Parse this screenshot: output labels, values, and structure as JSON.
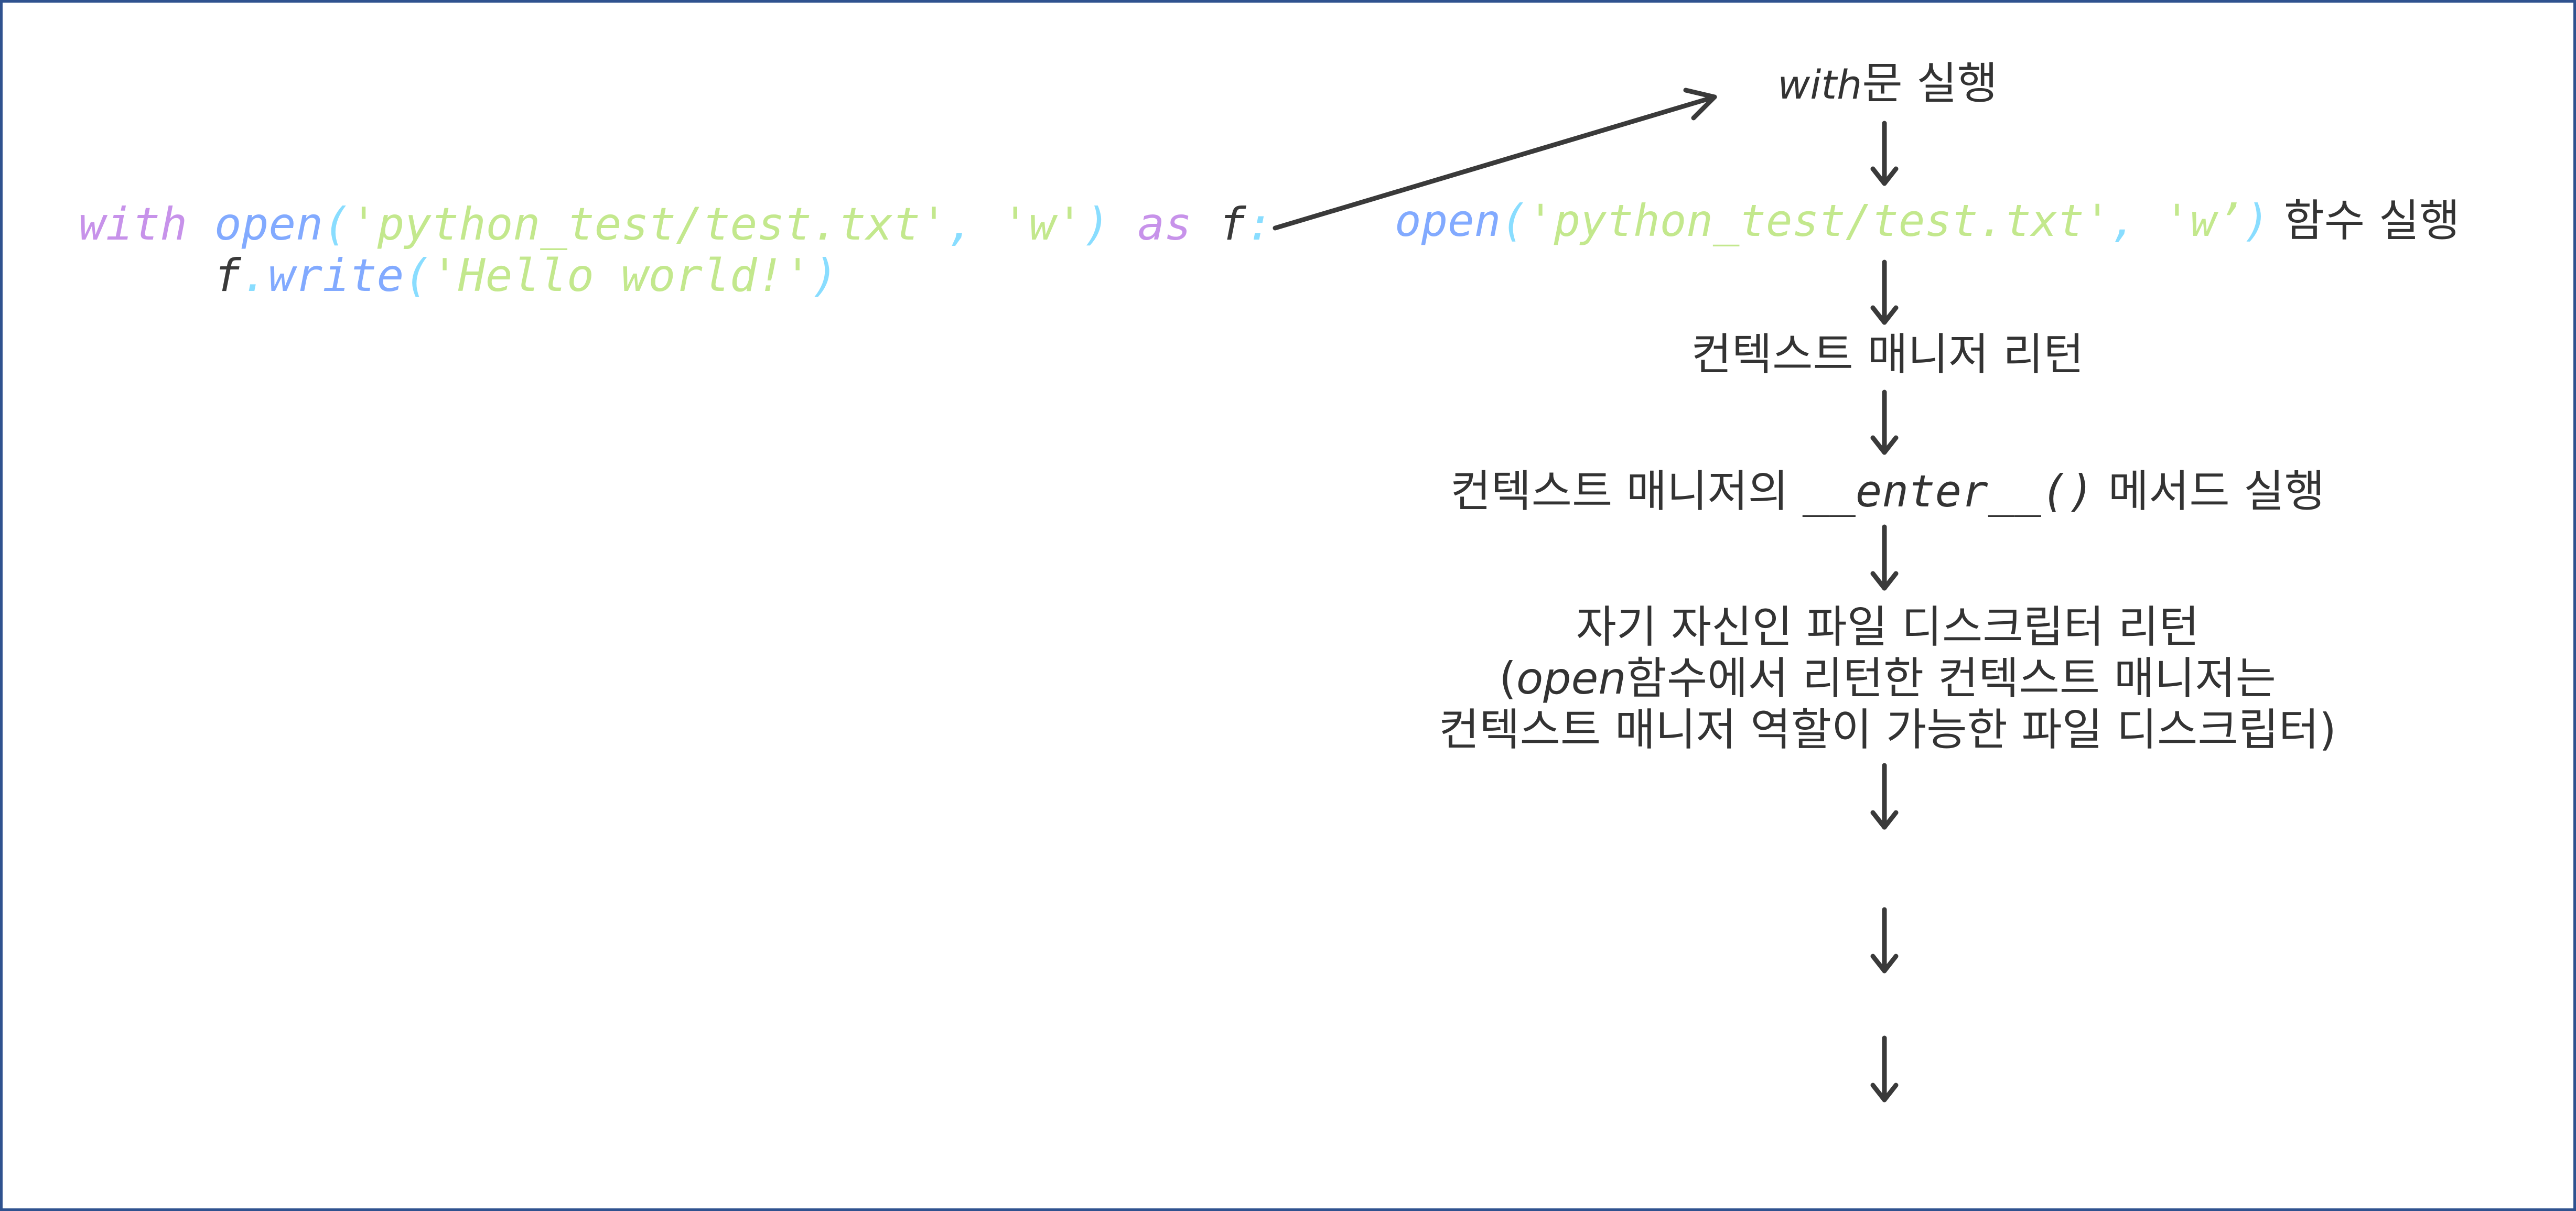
{
  "code": {
    "line1": {
      "kw_with": "with",
      "fn_open": "open",
      "p1": "(",
      "q1": "'",
      "path": "python_test/test.txt",
      "q2": "'",
      "comma": ",",
      "q3": "'",
      "mode": "w",
      "q4": "'",
      "p2": ")",
      "kw_as": "as",
      "var_f": "f",
      "colon": ":"
    },
    "line2": {
      "var_f": "f",
      "dot": ".",
      "fn_write": "write",
      "p1": "(",
      "str": "'Hello world!'",
      "p2": ")"
    }
  },
  "flow": {
    "title": {
      "with_word": "with",
      "rest": "문 실행"
    },
    "step1": {
      "fn_open": "open",
      "p1": "(",
      "q1": "'",
      "path": "python_test/test.txt",
      "q2": "'",
      "comma": ",",
      "q3": "'",
      "mode": "w",
      "q4": "’",
      "p2": ")",
      "suffix": " 함수 실행"
    },
    "step2": "컨텍스트 매니저 리턴",
    "step3": {
      "prefix": "컨텍스트 매니저의 ",
      "method": "__enter__()",
      "suffix": " 메서드 실행"
    },
    "step4": {
      "line1": "자기 자신인 파일 디스크립터 리턴",
      "line2_open_paren": "(",
      "line2_open": "open",
      "line2_rest": "함수에서 리턴한 컨텍스트 매니저는",
      "line3": "컨텍스트 매니저 역할이 가능한 파일 디스크립터)"
    }
  },
  "colors": {
    "border": "#2f528f",
    "keyword": "#c792ea",
    "function": "#82aaff",
    "punctuation": "#89ddff",
    "string": "#c3e88d",
    "text": "#333333"
  }
}
